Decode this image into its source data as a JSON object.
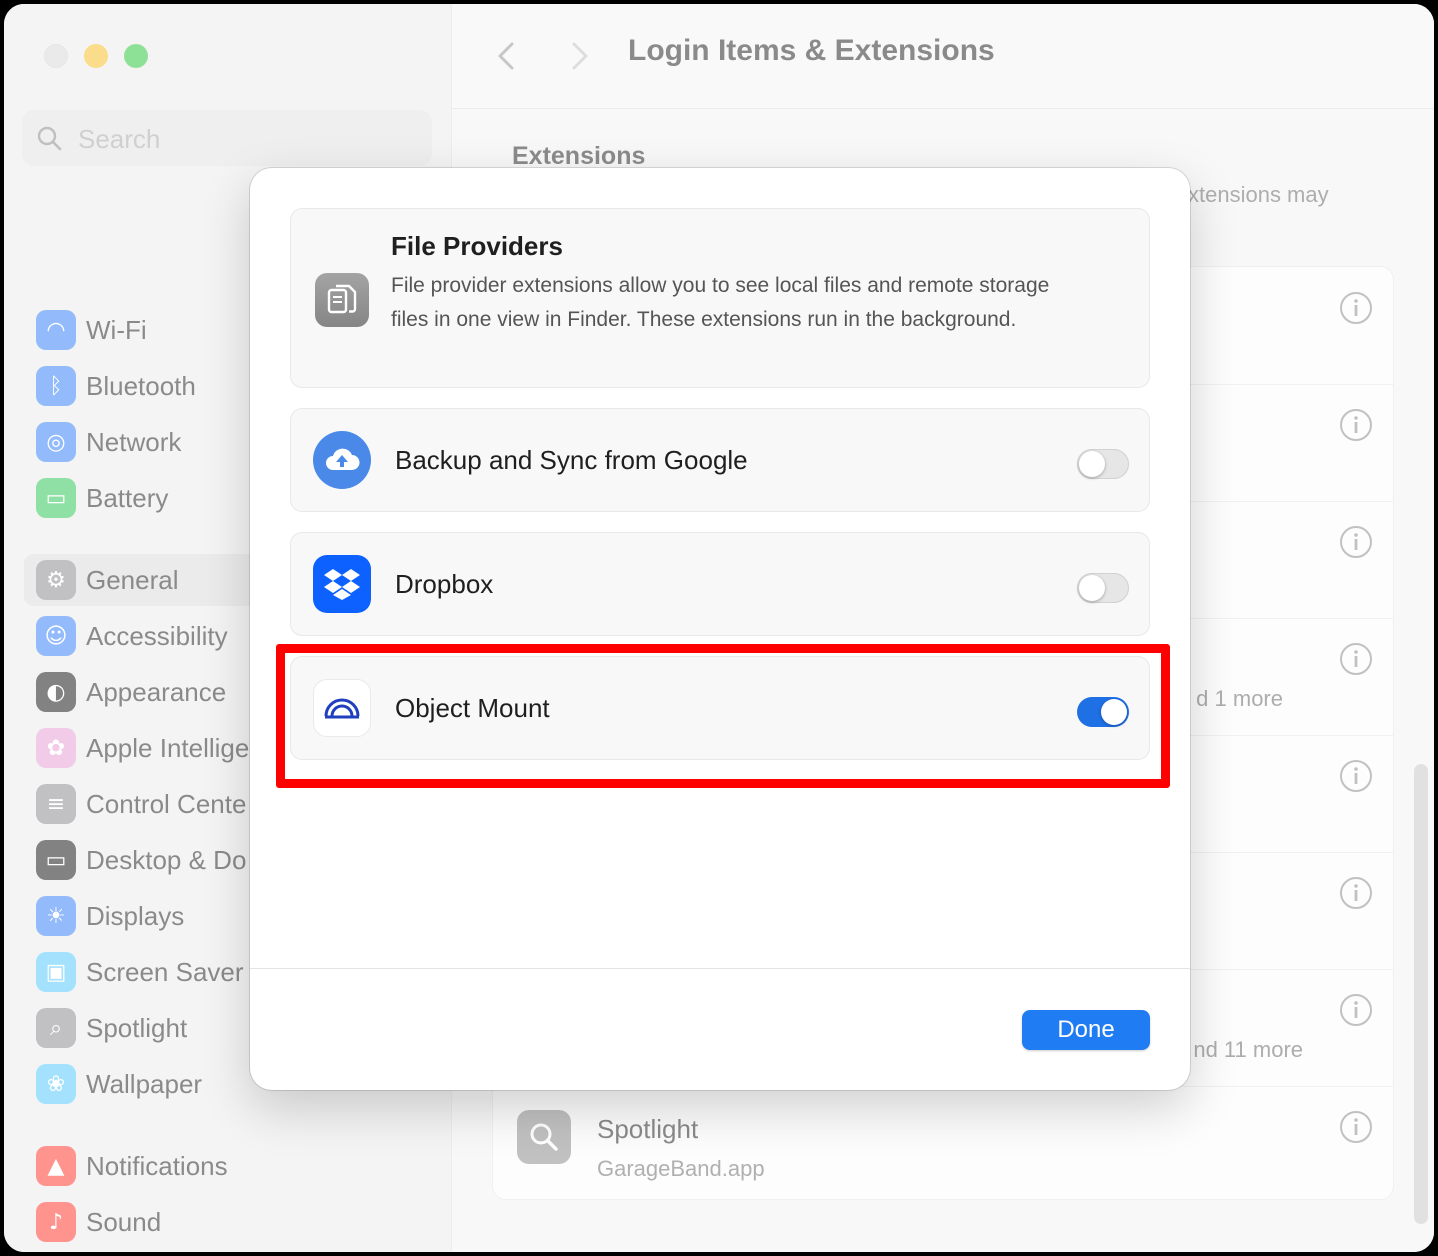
{
  "window": {
    "title": "Login Items & Extensions",
    "search_placeholder": "Search"
  },
  "sidebar": {
    "items": [
      {
        "label": "Wi-Fi",
        "icon": "wifi-icon",
        "color": "#3b82f6"
      },
      {
        "label": "Bluetooth",
        "icon": "bluetooth-icon",
        "color": "#3b82f6"
      },
      {
        "label": "Network",
        "icon": "globe-icon",
        "color": "#3b82f6"
      },
      {
        "label": "Battery",
        "icon": "battery-icon",
        "color": "#34c759"
      },
      {
        "label": "General",
        "icon": "gear-icon",
        "color": "#8e8e93"
      },
      {
        "label": "Accessibility",
        "icon": "accessibility-icon",
        "color": "#3b82f6"
      },
      {
        "label": "Appearance",
        "icon": "appearance-icon",
        "color": "#1c1c1e"
      },
      {
        "label": "Apple Intellige",
        "icon": "apple-intelligence-icon",
        "color": "#e8a0d8"
      },
      {
        "label": "Control Cente",
        "icon": "control-center-icon",
        "color": "#8e8e93"
      },
      {
        "label": "Desktop & Do",
        "icon": "desktop-dock-icon",
        "color": "#1c1c1e"
      },
      {
        "label": "Displays",
        "icon": "displays-icon",
        "color": "#3b82f6"
      },
      {
        "label": "Screen Saver",
        "icon": "screen-saver-icon",
        "color": "#5ac8fa"
      },
      {
        "label": "Spotlight",
        "icon": "spotlight-icon",
        "color": "#8e8e93"
      },
      {
        "label": "Wallpaper",
        "icon": "wallpaper-icon",
        "color": "#5ac8fa"
      },
      {
        "label": "Notifications",
        "icon": "notifications-icon",
        "color": "#ff3b30"
      },
      {
        "label": "Sound",
        "icon": "sound-icon",
        "color": "#ff3b30"
      }
    ],
    "active_index": 4
  },
  "main": {
    "section_title": "Extensions",
    "section_desc_partial": "xtensions may",
    "rows_extra": [
      "d 1 more",
      "nd 11 more"
    ],
    "spotlight_row": {
      "name": "Spotlight",
      "subtitle": "GarageBand.app"
    }
  },
  "sheet": {
    "file_providers": {
      "title": "File Providers",
      "description": "File provider extensions allow you to see local files and remote storage files in one view in Finder. These extensions run in the background."
    },
    "apps": [
      {
        "name": "Backup and Sync from Google",
        "enabled": false,
        "icon": "google-backup-icon"
      },
      {
        "name": "Dropbox",
        "enabled": false,
        "icon": "dropbox-icon"
      },
      {
        "name": "Object Mount",
        "enabled": true,
        "icon": "object-mount-icon"
      }
    ],
    "done_label": "Done"
  },
  "colors": {
    "accent": "#1f7cf3",
    "highlight": "#ff0000"
  }
}
